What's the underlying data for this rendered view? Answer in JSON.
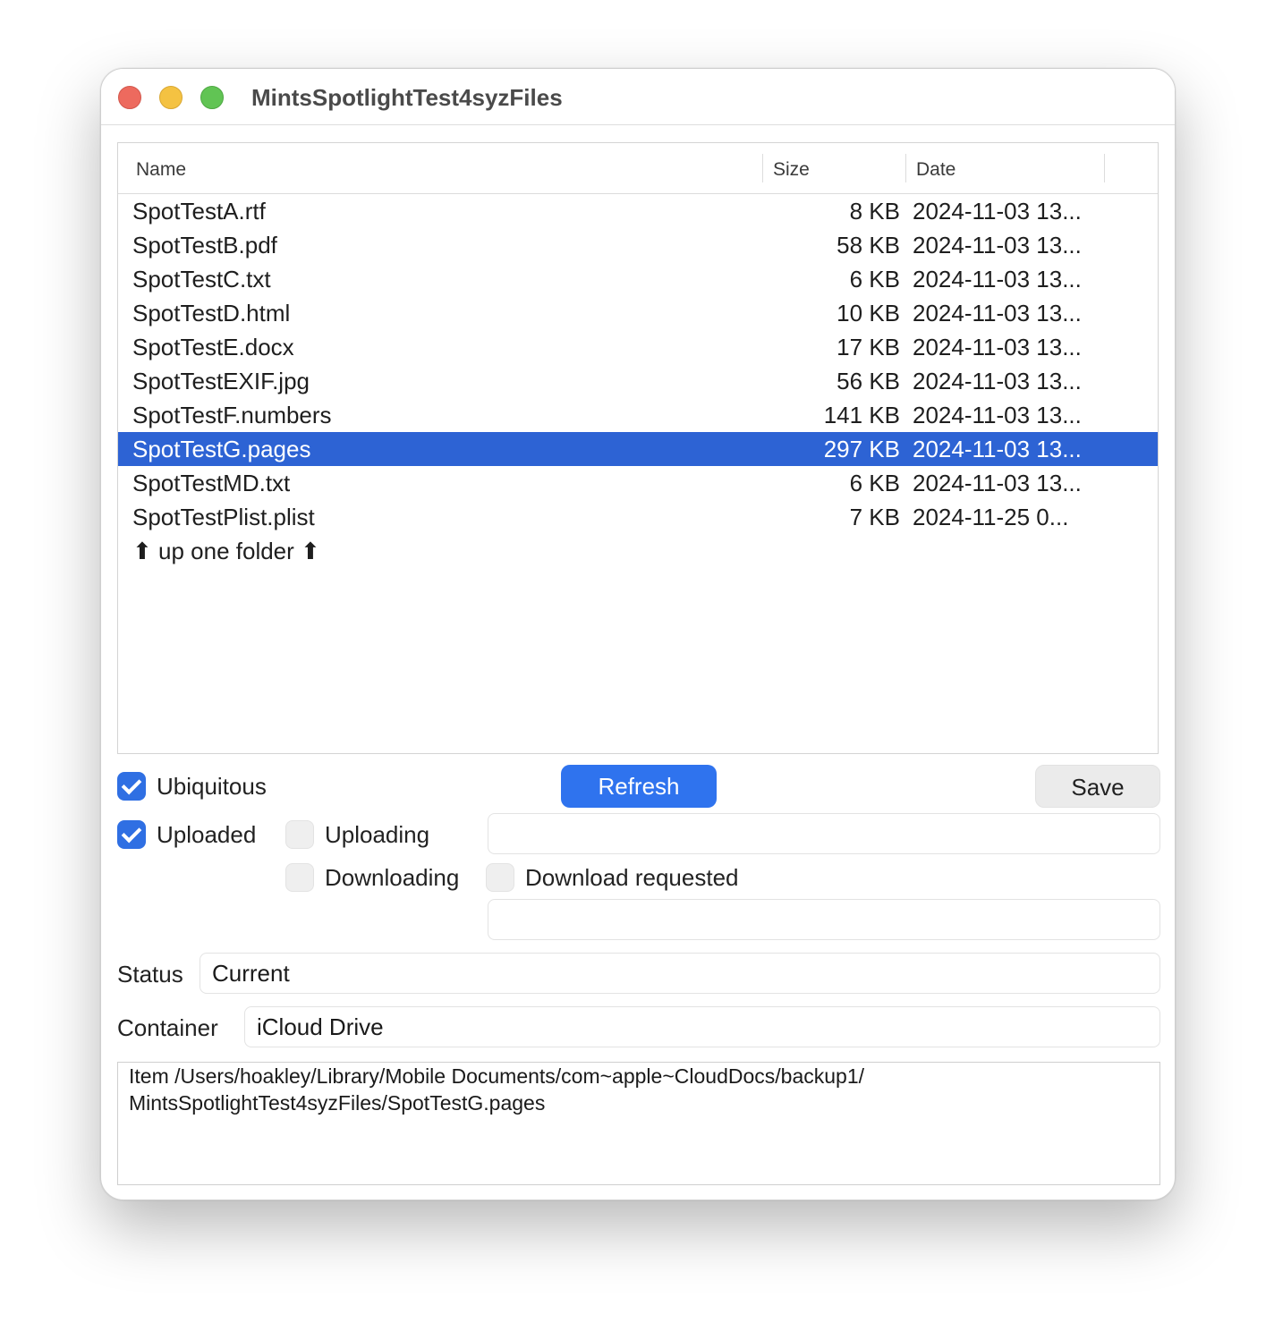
{
  "window": {
    "title": "MintsSpotlightTest4syzFiles"
  },
  "table": {
    "columns": {
      "name": "Name",
      "size": "Size",
      "date": "Date"
    },
    "rows": [
      {
        "name": "SpotTestA.rtf",
        "size": "8 KB",
        "date": "2024-11-03 13..."
      },
      {
        "name": "SpotTestB.pdf",
        "size": "58 KB",
        "date": "2024-11-03 13..."
      },
      {
        "name": "SpotTestC.txt",
        "size": "6 KB",
        "date": "2024-11-03 13..."
      },
      {
        "name": "SpotTestD.html",
        "size": "10 KB",
        "date": "2024-11-03 13..."
      },
      {
        "name": "SpotTestE.docx",
        "size": "17 KB",
        "date": "2024-11-03 13..."
      },
      {
        "name": "SpotTestEXIF.jpg",
        "size": "56 KB",
        "date": "2024-11-03 13..."
      },
      {
        "name": "SpotTestF.numbers",
        "size": "141 KB",
        "date": "2024-11-03 13..."
      },
      {
        "name": "SpotTestG.pages",
        "size": "297 KB",
        "date": "2024-11-03 13...",
        "selected": true
      },
      {
        "name": "SpotTestMD.txt",
        "size": "6 KB",
        "date": "2024-11-03 13..."
      },
      {
        "name": "SpotTestPlist.plist",
        "size": "7 KB",
        "date": "2024-11-25 0..."
      },
      {
        "name": "⬆ up one folder ⬆",
        "size": "",
        "date": ""
      }
    ]
  },
  "controls": {
    "ubiquitous": {
      "label": "Ubiquitous",
      "checked": true
    },
    "refresh_label": "Refresh",
    "save_label": "Save",
    "uploaded": {
      "label": "Uploaded",
      "checked": true
    },
    "uploading": {
      "label": "Uploading",
      "checked": false
    },
    "downloading": {
      "label": "Downloading",
      "checked": false
    },
    "download_requested": {
      "label": "Download requested",
      "checked": false
    },
    "upload_error_value": "",
    "download_error_value": "",
    "status": {
      "label": "Status",
      "value": "Current"
    },
    "container": {
      "label": "Container",
      "value": "iCloud Drive"
    },
    "item_info": {
      "line1": "Item /Users/hoakley/Library/Mobile Documents/com~apple~CloudDocs/backup1/",
      "line2": "MintsSpotlightTest4syzFiles/SpotTestG.pages"
    }
  },
  "colors": {
    "selection": "#2d63d4",
    "accent": "#2f73ee",
    "close": "#ed6a5e",
    "minimize": "#f4c242",
    "maximize": "#61c454"
  }
}
